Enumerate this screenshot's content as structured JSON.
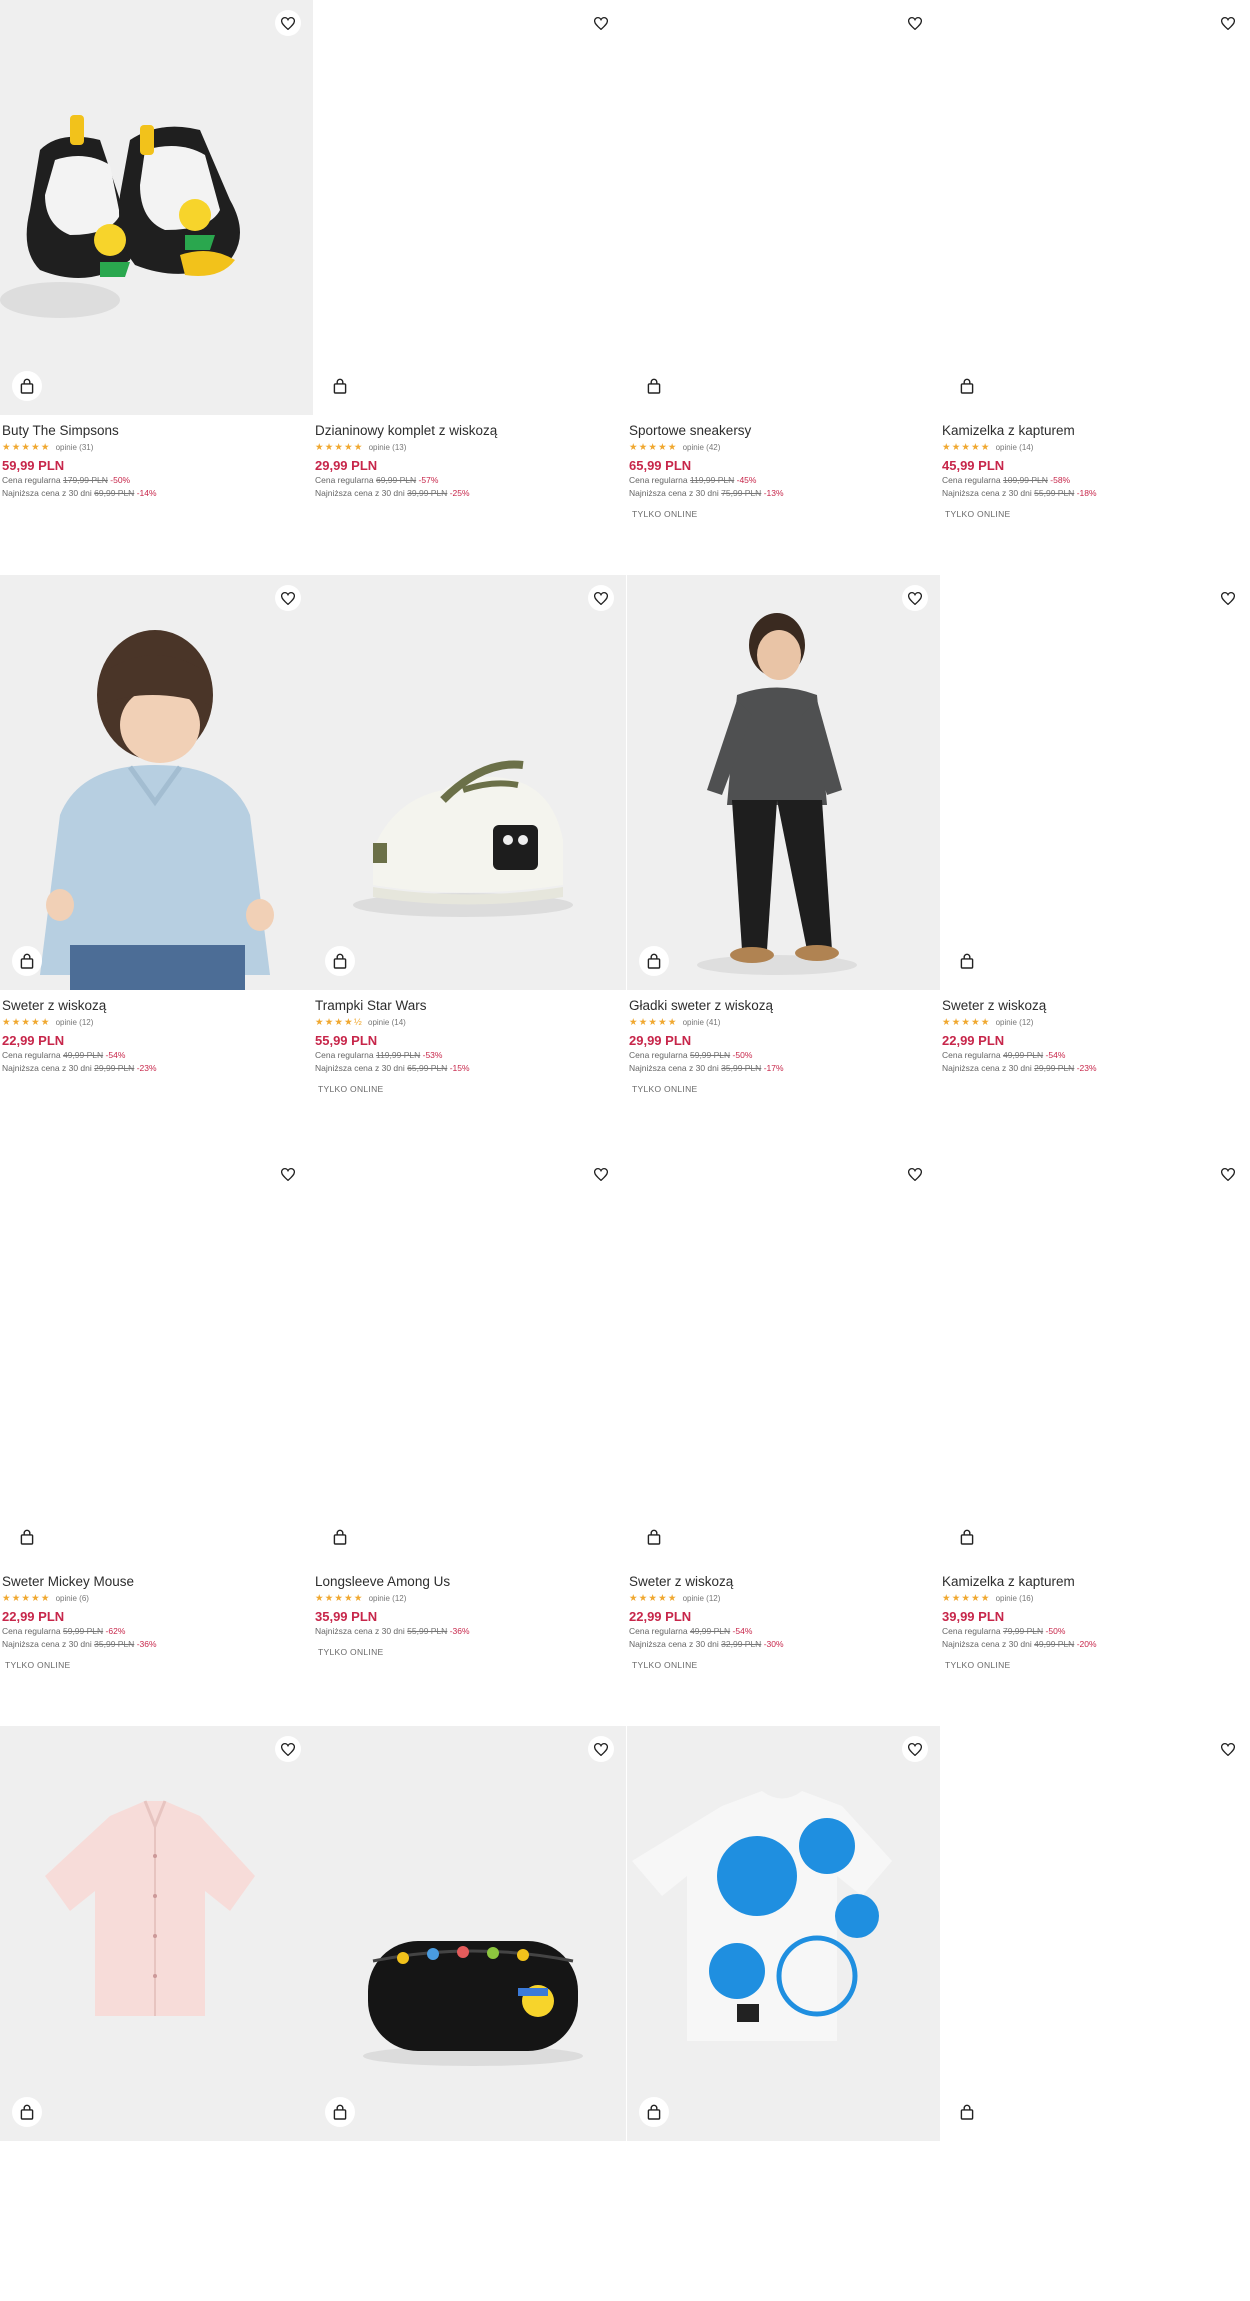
{
  "products": [
    {
      "name": "Buty The Simpsons",
      "stars": "★★★★★",
      "reviews": "opinie (31)",
      "price": "59,99 PLN",
      "regular_label": "Cena regularna",
      "regular_price": "179,99 PLN",
      "regular_discount": "-50%",
      "lowest_label": "Najniższa cena z 30 dni",
      "lowest_price": "69,99 PLN",
      "lowest_discount": "-14%",
      "badge": "",
      "image": "shoes"
    },
    {
      "name": "Dzianinowy komplet z wiskozą",
      "stars": "★★★★★",
      "reviews": "opinie (13)",
      "price": "29,99 PLN",
      "regular_label": "Cena regularna",
      "regular_price": "69,99 PLN",
      "regular_discount": "-57%",
      "lowest_label": "Najniższa cena z 30 dni",
      "lowest_price": "39,99 PLN",
      "lowest_discount": "-25%",
      "badge": "",
      "image": "blank"
    },
    {
      "name": "Sportowe sneakersy",
      "stars": "★★★★★",
      "reviews": "opinie (42)",
      "price": "65,99 PLN",
      "regular_label": "Cena regularna",
      "regular_price": "119,99 PLN",
      "regular_discount": "-45%",
      "lowest_label": "Najniższa cena z 30 dni",
      "lowest_price": "75,99 PLN",
      "lowest_discount": "-13%",
      "badge": "TYLKO ONLINE",
      "image": "blank"
    },
    {
      "name": "Kamizelka z kapturem",
      "stars": "★★★★★",
      "reviews": "opinie (14)",
      "price": "45,99 PLN",
      "regular_label": "Cena regularna",
      "regular_price": "109,99 PLN",
      "regular_discount": "-58%",
      "lowest_label": "Najniższa cena z 30 dni",
      "lowest_price": "55,99 PLN",
      "lowest_discount": "-18%",
      "badge": "TYLKO ONLINE",
      "image": "blank"
    },
    {
      "name": "Sweter z wiskozą",
      "stars": "★★★★★",
      "reviews": "opinie (12)",
      "price": "22,99 PLN",
      "regular_label": "Cena regularna",
      "regular_price": "49,99 PLN",
      "regular_discount": "-54%",
      "lowest_label": "Najniższa cena z 30 dni",
      "lowest_price": "29,99 PLN",
      "lowest_discount": "-23%",
      "badge": "",
      "image": "kid-sweater"
    },
    {
      "name": "Trampki Star Wars",
      "stars": "★★★★½",
      "reviews": "opinie (14)",
      "price": "55,99 PLN",
      "regular_label": "Cena regularna",
      "regular_price": "119,99 PLN",
      "regular_discount": "-53%",
      "lowest_label": "Najniższa cena z 30 dni",
      "lowest_price": "65,99 PLN",
      "lowest_discount": "-15%",
      "badge": "TYLKO ONLINE",
      "image": "sneaker"
    },
    {
      "name": "Gładki sweter z wiskozą",
      "stars": "★★★★★",
      "reviews": "opinie (41)",
      "price": "29,99 PLN",
      "regular_label": "Cena regularna",
      "regular_price": "59,99 PLN",
      "regular_discount": "-50%",
      "lowest_label": "Najniższa cena z 30 dni",
      "lowest_price": "35,99 PLN",
      "lowest_discount": "-17%",
      "badge": "TYLKO ONLINE",
      "image": "boy"
    },
    {
      "name": "Sweter z wiskozą",
      "stars": "★★★★★",
      "reviews": "opinie (12)",
      "price": "22,99 PLN",
      "regular_label": "Cena regularna",
      "regular_price": "49,99 PLN",
      "regular_discount": "-54%",
      "lowest_label": "Najniższa cena z 30 dni",
      "lowest_price": "29,99 PLN",
      "lowest_discount": "-23%",
      "badge": "",
      "image": "blank"
    },
    {
      "name": "Sweter Mickey Mouse",
      "stars": "★★★★★",
      "reviews": "opinie (6)",
      "price": "22,99 PLN",
      "regular_label": "Cena regularna",
      "regular_price": "59,99 PLN",
      "regular_discount": "-62%",
      "lowest_label": "Najniższa cena z 30 dni",
      "lowest_price": "35,99 PLN",
      "lowest_discount": "-36%",
      "badge": "TYLKO ONLINE",
      "image": "blank"
    },
    {
      "name": "Longsleeve Among Us",
      "stars": "★★★★★",
      "reviews": "opinie (12)",
      "price": "35,99 PLN",
      "regular_label": "",
      "regular_price": "",
      "regular_discount": "",
      "lowest_label": "Najniższa cena z 30 dni",
      "lowest_price": "55,99 PLN",
      "lowest_discount": "-36%",
      "badge": "TYLKO ONLINE",
      "image": "blank"
    },
    {
      "name": "Sweter z wiskozą",
      "stars": "★★★★★",
      "reviews": "opinie (12)",
      "price": "22,99 PLN",
      "regular_label": "Cena regularna",
      "regular_price": "49,99 PLN",
      "regular_discount": "-54%",
      "lowest_label": "Najniższa cena z 30 dni",
      "lowest_price": "32,99 PLN",
      "lowest_discount": "-30%",
      "badge": "TYLKO ONLINE",
      "image": "blank"
    },
    {
      "name": "Kamizelka z kapturem",
      "stars": "★★★★★",
      "reviews": "opinie (16)",
      "price": "39,99 PLN",
      "regular_label": "Cena regularna",
      "regular_price": "79,99 PLN",
      "regular_discount": "-50%",
      "lowest_label": "Najniższa cena z 30 dni",
      "lowest_price": "49,99 PLN",
      "lowest_discount": "-20%",
      "badge": "TYLKO ONLINE",
      "image": "blank"
    },
    {
      "name": "",
      "stars": "",
      "reviews": "",
      "price": "",
      "regular_label": "",
      "regular_price": "",
      "regular_discount": "",
      "lowest_label": "",
      "lowest_price": "",
      "lowest_discount": "",
      "badge": "",
      "image": "shirt"
    },
    {
      "name": "",
      "stars": "",
      "reviews": "",
      "price": "",
      "regular_label": "",
      "regular_price": "",
      "regular_discount": "",
      "lowest_label": "",
      "lowest_price": "",
      "lowest_discount": "",
      "badge": "",
      "image": "pouch"
    },
    {
      "name": "",
      "stars": "",
      "reviews": "",
      "price": "",
      "regular_label": "",
      "regular_price": "",
      "regular_discount": "",
      "lowest_label": "",
      "lowest_price": "",
      "lowest_discount": "",
      "badge": "",
      "image": "tshirt"
    },
    {
      "name": "",
      "stars": "",
      "reviews": "",
      "price": "",
      "regular_label": "",
      "regular_price": "",
      "regular_discount": "",
      "lowest_label": "",
      "lowest_price": "",
      "lowest_discount": "",
      "badge": "",
      "image": "blank"
    }
  ],
  "icons": {
    "wishlist": "heart-icon",
    "cart": "shopping-bag-icon"
  },
  "colors": {
    "price": "#c7264a",
    "stars": "#f0a830",
    "image_bg": "#efefef"
  }
}
